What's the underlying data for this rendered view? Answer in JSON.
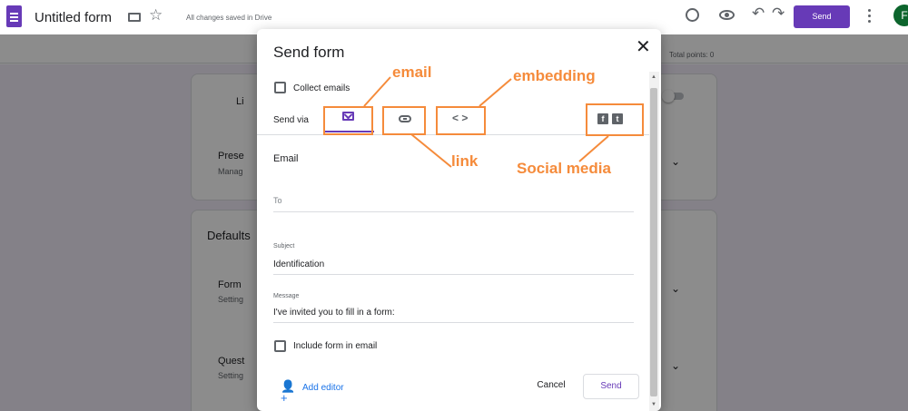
{
  "app": {
    "title": "Untitled form",
    "saved_status": "All changes saved in Drive",
    "send_label": "Send",
    "avatar_letter": "F",
    "brand_color": "#673ab7"
  },
  "editor": {
    "total_points": "Total points: 0",
    "items": {
      "li": "Li",
      "prese": "Prese",
      "manag": "Manag",
      "defaults": "Defaults",
      "form": "Form",
      "setting1": "Setting",
      "quest": "Quest",
      "setting2": "Setting"
    }
  },
  "dialog": {
    "title": "Send form",
    "collect_emails": "Collect emails",
    "send_via": "Send via",
    "section_title": "Email",
    "to_placeholder": "To",
    "subject_label": "Subject",
    "subject_value": "Identification",
    "message_label": "Message",
    "message_value": "I've invited you to fill in a form:",
    "include_form": "Include form in email",
    "add_editor": "Add editor",
    "cancel": "Cancel",
    "send": "Send",
    "icons": [
      "mail-icon",
      "link-icon",
      "embed-icon",
      "facebook-icon",
      "twitter-icon",
      "close-icon",
      "add-person-icon"
    ]
  },
  "annotations": {
    "email": "email",
    "embedding": "embedding",
    "link": "link",
    "social_media": "Social media",
    "color": "#f58b3b"
  }
}
